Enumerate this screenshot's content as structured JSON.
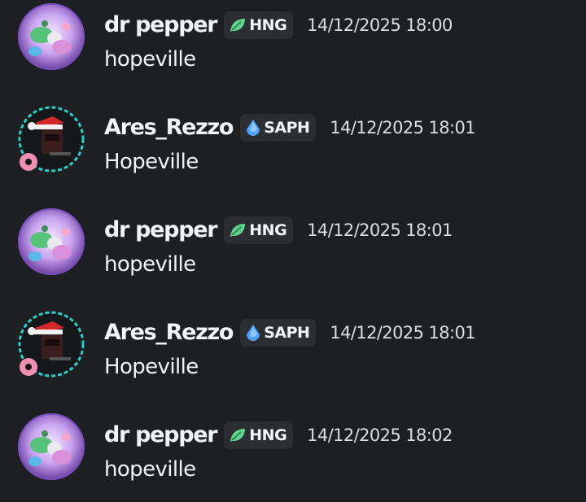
{
  "colors": {
    "background": "#1e1f22",
    "text": "#f2f3f5",
    "timestamp": "#dbdee1",
    "tag_background": "#2b2d31",
    "hng_icon": "#5fd38d",
    "saph_icon": "#4fa3ff"
  },
  "messages": [
    {
      "username": "dr pepper",
      "avatar_icon": "dr-pepper-avatar",
      "tag": {
        "label": "HNG",
        "icon": "leaf-icon"
      },
      "timestamp": "14/12/2025 18:00",
      "content": "hopeville"
    },
    {
      "username": "Ares_Rezzo",
      "avatar_icon": "ares-rezzo-avatar",
      "tag": {
        "label": "SAPH",
        "icon": "droplet-icon"
      },
      "timestamp": "14/12/2025 18:01",
      "content": "Hopeville"
    },
    {
      "username": "dr pepper",
      "avatar_icon": "dr-pepper-avatar",
      "tag": {
        "label": "HNG",
        "icon": "leaf-icon"
      },
      "timestamp": "14/12/2025 18:01",
      "content": "hopeville"
    },
    {
      "username": "Ares_Rezzo",
      "avatar_icon": "ares-rezzo-avatar",
      "tag": {
        "label": "SAPH",
        "icon": "droplet-icon"
      },
      "timestamp": "14/12/2025 18:01",
      "content": "Hopeville"
    },
    {
      "username": "dr pepper",
      "avatar_icon": "dr-pepper-avatar",
      "tag": {
        "label": "HNG",
        "icon": "leaf-icon"
      },
      "timestamp": "14/12/2025 18:02",
      "content": "hopeville"
    }
  ]
}
